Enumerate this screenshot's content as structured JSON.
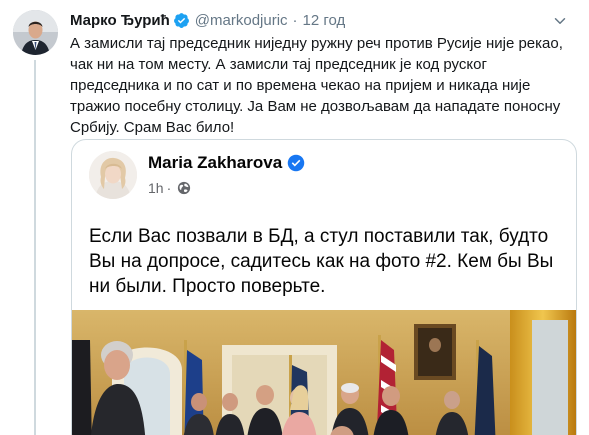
{
  "tweet": {
    "author_name": "Марко Ђурић",
    "author_handle": "@markodjuric",
    "separator": "·",
    "time": "12 год",
    "text": "А замисли тај председник ниједну ружну реч против Русије није рекао, чак ни на том месту. А замисли тај председник је код руског председника и по сат и по времена чекао на пријем и никада није тражио посебну столицу. Ја Вам не дозвољавам да нападате поносну Србију. Срам Вас било!"
  },
  "embedded_post": {
    "author_name": "Maria Zakharova",
    "time": "1h",
    "separator": "·",
    "text": "Если Вас позвали в БД, а стул поставили так, будто Вы на допросе, садитесь как на фото #2. Кем бы Вы ни были. Просто поверьте."
  },
  "colors": {
    "verified": "#1da1f2",
    "fb_verified": "#1877f2",
    "secondary_text": "#657786",
    "border": "#cfd9de"
  },
  "icons": {
    "verified": "verified-badge-icon",
    "menu": "chevron-down-icon",
    "globe": "globe-icon"
  }
}
